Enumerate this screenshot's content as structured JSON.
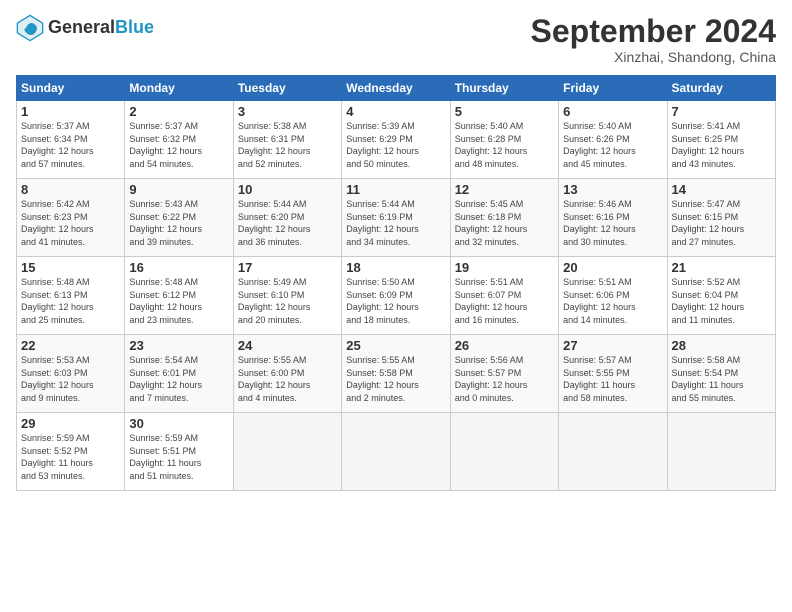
{
  "logo": {
    "line1": "General",
    "line2": "Blue"
  },
  "title": "September 2024",
  "location": "Xinzhai, Shandong, China",
  "headers": [
    "Sunday",
    "Monday",
    "Tuesday",
    "Wednesday",
    "Thursday",
    "Friday",
    "Saturday"
  ],
  "weeks": [
    [
      {
        "day": "1",
        "info": "Sunrise: 5:37 AM\nSunset: 6:34 PM\nDaylight: 12 hours\nand 57 minutes."
      },
      {
        "day": "2",
        "info": "Sunrise: 5:37 AM\nSunset: 6:32 PM\nDaylight: 12 hours\nand 54 minutes."
      },
      {
        "day": "3",
        "info": "Sunrise: 5:38 AM\nSunset: 6:31 PM\nDaylight: 12 hours\nand 52 minutes."
      },
      {
        "day": "4",
        "info": "Sunrise: 5:39 AM\nSunset: 6:29 PM\nDaylight: 12 hours\nand 50 minutes."
      },
      {
        "day": "5",
        "info": "Sunrise: 5:40 AM\nSunset: 6:28 PM\nDaylight: 12 hours\nand 48 minutes."
      },
      {
        "day": "6",
        "info": "Sunrise: 5:40 AM\nSunset: 6:26 PM\nDaylight: 12 hours\nand 45 minutes."
      },
      {
        "day": "7",
        "info": "Sunrise: 5:41 AM\nSunset: 6:25 PM\nDaylight: 12 hours\nand 43 minutes."
      }
    ],
    [
      {
        "day": "8",
        "info": "Sunrise: 5:42 AM\nSunset: 6:23 PM\nDaylight: 12 hours\nand 41 minutes."
      },
      {
        "day": "9",
        "info": "Sunrise: 5:43 AM\nSunset: 6:22 PM\nDaylight: 12 hours\nand 39 minutes."
      },
      {
        "day": "10",
        "info": "Sunrise: 5:44 AM\nSunset: 6:20 PM\nDaylight: 12 hours\nand 36 minutes."
      },
      {
        "day": "11",
        "info": "Sunrise: 5:44 AM\nSunset: 6:19 PM\nDaylight: 12 hours\nand 34 minutes."
      },
      {
        "day": "12",
        "info": "Sunrise: 5:45 AM\nSunset: 6:18 PM\nDaylight: 12 hours\nand 32 minutes."
      },
      {
        "day": "13",
        "info": "Sunrise: 5:46 AM\nSunset: 6:16 PM\nDaylight: 12 hours\nand 30 minutes."
      },
      {
        "day": "14",
        "info": "Sunrise: 5:47 AM\nSunset: 6:15 PM\nDaylight: 12 hours\nand 27 minutes."
      }
    ],
    [
      {
        "day": "15",
        "info": "Sunrise: 5:48 AM\nSunset: 6:13 PM\nDaylight: 12 hours\nand 25 minutes."
      },
      {
        "day": "16",
        "info": "Sunrise: 5:48 AM\nSunset: 6:12 PM\nDaylight: 12 hours\nand 23 minutes."
      },
      {
        "day": "17",
        "info": "Sunrise: 5:49 AM\nSunset: 6:10 PM\nDaylight: 12 hours\nand 20 minutes."
      },
      {
        "day": "18",
        "info": "Sunrise: 5:50 AM\nSunset: 6:09 PM\nDaylight: 12 hours\nand 18 minutes."
      },
      {
        "day": "19",
        "info": "Sunrise: 5:51 AM\nSunset: 6:07 PM\nDaylight: 12 hours\nand 16 minutes."
      },
      {
        "day": "20",
        "info": "Sunrise: 5:51 AM\nSunset: 6:06 PM\nDaylight: 12 hours\nand 14 minutes."
      },
      {
        "day": "21",
        "info": "Sunrise: 5:52 AM\nSunset: 6:04 PM\nDaylight: 12 hours\nand 11 minutes."
      }
    ],
    [
      {
        "day": "22",
        "info": "Sunrise: 5:53 AM\nSunset: 6:03 PM\nDaylight: 12 hours\nand 9 minutes."
      },
      {
        "day": "23",
        "info": "Sunrise: 5:54 AM\nSunset: 6:01 PM\nDaylight: 12 hours\nand 7 minutes."
      },
      {
        "day": "24",
        "info": "Sunrise: 5:55 AM\nSunset: 6:00 PM\nDaylight: 12 hours\nand 4 minutes."
      },
      {
        "day": "25",
        "info": "Sunrise: 5:55 AM\nSunset: 5:58 PM\nDaylight: 12 hours\nand 2 minutes."
      },
      {
        "day": "26",
        "info": "Sunrise: 5:56 AM\nSunset: 5:57 PM\nDaylight: 12 hours\nand 0 minutes."
      },
      {
        "day": "27",
        "info": "Sunrise: 5:57 AM\nSunset: 5:55 PM\nDaylight: 11 hours\nand 58 minutes."
      },
      {
        "day": "28",
        "info": "Sunrise: 5:58 AM\nSunset: 5:54 PM\nDaylight: 11 hours\nand 55 minutes."
      }
    ],
    [
      {
        "day": "29",
        "info": "Sunrise: 5:59 AM\nSunset: 5:52 PM\nDaylight: 11 hours\nand 53 minutes."
      },
      {
        "day": "30",
        "info": "Sunrise: 5:59 AM\nSunset: 5:51 PM\nDaylight: 11 hours\nand 51 minutes."
      },
      {
        "day": "",
        "info": ""
      },
      {
        "day": "",
        "info": ""
      },
      {
        "day": "",
        "info": ""
      },
      {
        "day": "",
        "info": ""
      },
      {
        "day": "",
        "info": ""
      }
    ]
  ]
}
